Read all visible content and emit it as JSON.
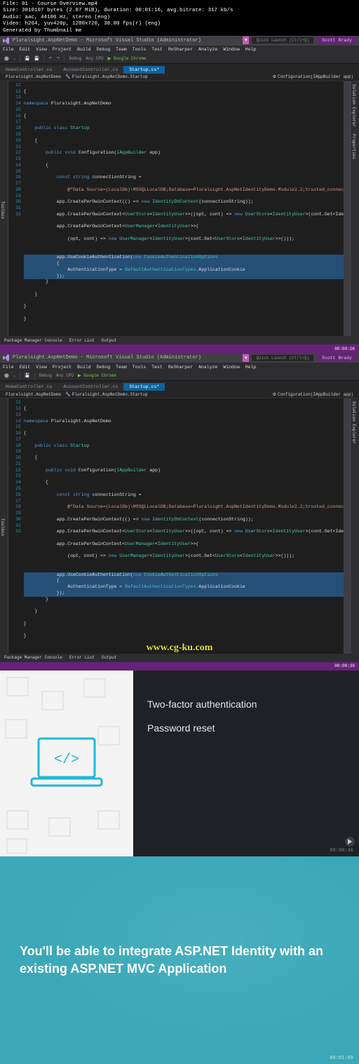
{
  "meta": {
    "file": "File: 01 - Course Overview.mp4",
    "size": "Size: 3010107 bytes (2.87 MiB), duration: 00:01:16, avg.bitrate: 317 kb/s",
    "audio": "Audio: aac, 44100 Hz, stereo (eng)",
    "video": "Video: h264, yuv420p, 1280x720, 30.00 fps(r) (eng)",
    "gen": "Generated by Thumbnail me"
  },
  "vs": {
    "title": "Pluralsight.AspNetDemo - Microsoft Visual Studio (Administrator)",
    "quick": "Quick Launch (Ctrl+Q)",
    "user": "Scott Brady",
    "menu": [
      "File",
      "Edit",
      "View",
      "Project",
      "Build",
      "Debug",
      "Team",
      "Tools",
      "Test",
      "ReSharper",
      "Analyze",
      "Window",
      "Help"
    ],
    "toolbar": {
      "config": "Debug",
      "platform": "Any CPU",
      "start": "Google Chrome"
    },
    "tabs": [
      "HomeController.cs",
      "AccountController.cs",
      "Startup.cs*"
    ],
    "breadcrumb": [
      "Pluralsight.AspNetDemo",
      "Pluralsight.AspNetDemo.Startup",
      "Configuration(IAppBuilder app)"
    ],
    "sidebarL": "Toolbox",
    "sidebarR1": "Solution Explorer",
    "sidebarR2": "Properties",
    "bottom": [
      "Package Manager Console",
      "Error List",
      "Output"
    ],
    "ts1": "00:00:26",
    "ts2": "00:00:30",
    "lines": [
      "11",
      "12",
      "13",
      "14",
      "15",
      "16",
      "17",
      "18",
      "19",
      "20",
      "21",
      "22",
      "23",
      "24",
      "25",
      "26",
      "27",
      "28",
      "29",
      "30",
      "31",
      "32"
    ],
    "code": {
      "l11": "{",
      "l12_b": "namespace ",
      "l12_t": "Pluralsight.AspNetDemo",
      "l13": "{",
      "l14_a": "    public class ",
      "l14_b": "Startup",
      "l15": "    {",
      "l16_a": "        public void ",
      "l16_b": "Configuration",
      "l16_c": "(",
      "l16_d": "IAppBuilder",
      "l16_e": " app)",
      "l17": "        {",
      "l18_a": "            const string ",
      "l18_b": "connectionString =",
      "l19_a": "                @",
      "l19_b": "\"Data Source=(LocalDb)\\MSSQLLocalDB;Database=Pluralsight.AspNetIdentityDemo.Module2.2;trusted_connec",
      "l20_a": "            app.CreatePerOwinContext(() => ",
      "l20_b": "new ",
      "l20_c": "IdentityDbContext",
      "l20_d": "(connectionString));",
      "l21_a": "            app.CreatePerOwinContext<",
      "l21_b": "UserStore",
      "l21_c": "<",
      "l21_d": "IdentityUser",
      "l21_e": ">>((opt, cont) => ",
      "l21_f": "new ",
      "l21_g": "UserStore",
      "l21_h": "<",
      "l21_i": "IdentityUser",
      "l21_j": ">(cont.Get<Ide",
      "l22_a": "            app.CreatePerOwinContext<",
      "l22_b": "UserManager",
      "l22_c": "<",
      "l22_d": "IdentityUser",
      "l22_e": ">>(",
      "l23_a": "                (opt, cont) => ",
      "l23_b": "new ",
      "l23_c": "UserManager",
      "l23_d": "<",
      "l23_e": "IdentityUser",
      "l23_f": ">(cont.Get<",
      "l23_g": "UserStore",
      "l23_h": "<",
      "l23_i": "IdentityUser",
      "l23_j": ">>()));",
      "l24": "",
      "l25_a": "            app.UseCookieAuthentication(",
      "l25_b": "new ",
      "l25_c": "CookieAuthenticationOptions",
      "l26": "            {",
      "l27_a": "                AuthenticationType = ",
      "l27_b": "DefaultAuthenticationTypes",
      "l27_c": ".ApplicationCookie",
      "l28": "            });",
      "l29": "        }",
      "l30": "    }",
      "l31": "}",
      "l32": "}"
    }
  },
  "watermark": "www.cg-ku.com",
  "slide3": {
    "h": "Two-factor authentication",
    "p": "Password reset",
    "ts": "00:00:46"
  },
  "slide4": {
    "text": "You'll be able to integrate ASP.NET Identity with an existing ASP.NET MVC Application",
    "ts": "00:01:09"
  }
}
